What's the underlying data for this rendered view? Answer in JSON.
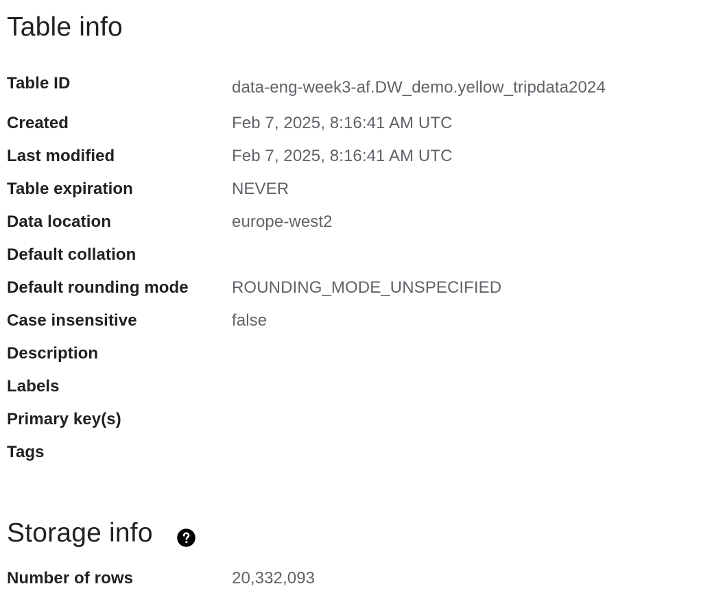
{
  "table_info": {
    "title": "Table info",
    "rows": [
      {
        "label": "Table ID",
        "value": "data-eng-week3-af.DW_demo.yellow_tripdata2024"
      },
      {
        "label": "Created",
        "value": "Feb 7, 2025, 8:16:41 AM UTC"
      },
      {
        "label": "Last modified",
        "value": "Feb 7, 2025, 8:16:41 AM UTC"
      },
      {
        "label": "Table expiration",
        "value": "NEVER"
      },
      {
        "label": "Data location",
        "value": "europe-west2"
      },
      {
        "label": "Default collation",
        "value": ""
      },
      {
        "label": "Default rounding mode",
        "value": "ROUNDING_MODE_UNSPECIFIED"
      },
      {
        "label": "Case insensitive",
        "value": "false"
      },
      {
        "label": "Description",
        "value": ""
      },
      {
        "label": "Labels",
        "value": ""
      },
      {
        "label": "Primary key(s)",
        "value": ""
      },
      {
        "label": "Tags",
        "value": ""
      }
    ]
  },
  "storage_info": {
    "title": "Storage info",
    "help_icon": "help-circle-icon",
    "rows": [
      {
        "label": "Number of rows",
        "value": "20,332,093"
      }
    ]
  }
}
